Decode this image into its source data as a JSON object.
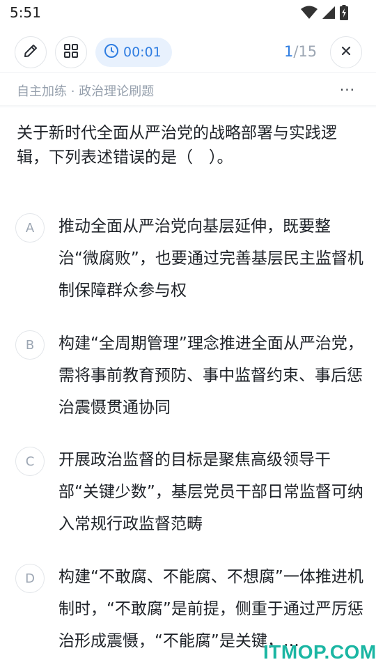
{
  "status_bar": {
    "time": "5:51"
  },
  "toolbar": {
    "timer": "00:01",
    "progress_current": "1",
    "progress_total": "/15"
  },
  "subheader": {
    "title": "自主加练 · 政治理论刷题",
    "more": "···"
  },
  "question": {
    "text": "关于新时代全面从严治党的战略部署与实践逻辑，下列表述错误的是（　）。"
  },
  "options": [
    {
      "letter": "A",
      "text": "推动全面从严治党向基层延伸，既要整治“微腐败”，也要通过完善基层民主监督机制保障群众参与权"
    },
    {
      "letter": "B",
      "text": "构建“全周期管理”理念推进全面从严治党，需将事前教育预防、事中监督约束、事后惩治震慑贯通协同"
    },
    {
      "letter": "C",
      "text": "开展政治监督的目标是聚焦高级领导干部“关键少数”，基层党员干部日常监督可纳入常规行政监督范畴"
    },
    {
      "letter": "D",
      "text": "构建“不敢腐、不能腐、不想腐”一体推进机制时，“不敢腐”是前提，侧重于通过严厉惩治形成震慑，“不能腐”是关键，…"
    }
  ],
  "watermark": "ITMOP.COM",
  "colors": {
    "accent": "#2f7de1",
    "muted": "#96a0ad",
    "watermark": "#1bb6a3"
  },
  "icons": [
    "pencil-icon",
    "grid-icon",
    "clock-icon",
    "close-icon",
    "wifi-icon",
    "signal-icon",
    "battery-icon"
  ]
}
